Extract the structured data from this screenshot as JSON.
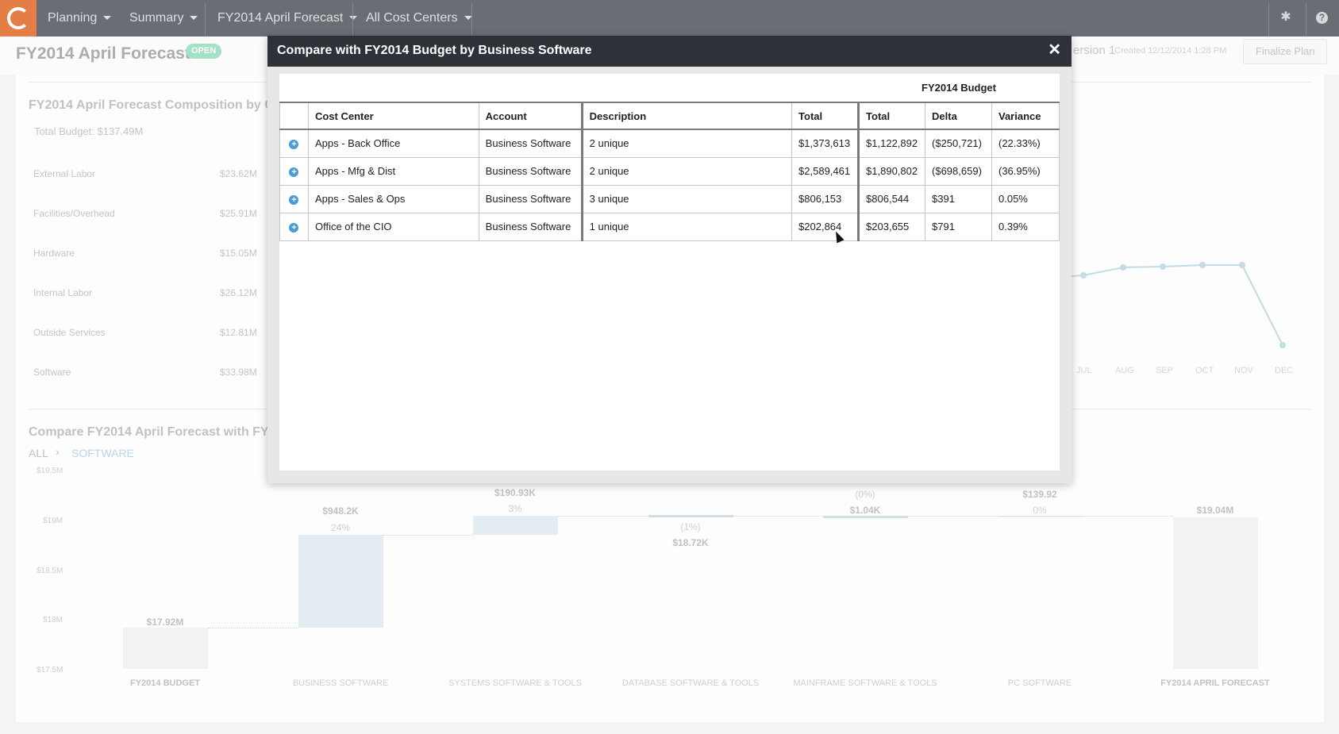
{
  "nav": {
    "items": [
      {
        "label": "Planning"
      },
      {
        "label": "Summary"
      },
      {
        "label": "FY2014 April Forecast"
      },
      {
        "label": "All Cost Centers"
      }
    ],
    "icons": {
      "settings": "gear-icon",
      "help": "question-icon",
      "logo": "app-logo"
    }
  },
  "header": {
    "title": "FY2014 April Forecast",
    "status": "OPEN",
    "version": "ersion 1",
    "created": "Created 12/12/2014 1:28 PM",
    "finalize_label": "Finalize Plan"
  },
  "composition": {
    "title": "FY2014 April Forecast Composition by Co",
    "total_budget": "Total Budget: $137.49M",
    "rows": [
      {
        "label": "External Labor",
        "value": "$23.62M"
      },
      {
        "label": "Facilities/Overhead",
        "value": "$25.91M"
      },
      {
        "label": "Hardware",
        "value": "$15.05M"
      },
      {
        "label": "Internal Labor",
        "value": "$26.12M"
      },
      {
        "label": "Outside Services",
        "value": "$12.81M"
      },
      {
        "label": "Software",
        "value": "$33.98M"
      }
    ]
  },
  "monthly_chart": {
    "months": [
      "JUL",
      "AUG",
      "SEP",
      "OCT",
      "NOV",
      "DEC"
    ],
    "line_color": "#b7d3e0"
  },
  "compare": {
    "title": "Compare FY2014 April Forecast with FY20",
    "breadcrumb": {
      "root": "ALL",
      "current": "SOFTWARE"
    },
    "y_axis": [
      "$19.5M",
      "$19M",
      "$18.5M",
      "$18M",
      "$17.5M"
    ],
    "bars": [
      {
        "category": "FY2014 BUDGET",
        "value": "$17.92M",
        "pct": ""
      },
      {
        "category": "BUSINESS SOFTWARE",
        "value": "$948.2K",
        "pct": "24%"
      },
      {
        "category": "SYSTEMS SOFTWARE & TOOLS",
        "value": "$190.93K",
        "pct": "3%"
      },
      {
        "category": "DATABASE SOFTWARE & TOOLS",
        "value": "$18.72K",
        "pct": "(1%)"
      },
      {
        "category": "MAINFRAME SOFTWARE & TOOLS",
        "value": "$1.04K",
        "pct": "(0%)"
      },
      {
        "category": "PC SOFTWARE",
        "value": "$139.92",
        "pct": "0%"
      },
      {
        "category": "FY2014 APRIL FORECAST",
        "value": "$19.04M",
        "pct": ""
      }
    ]
  },
  "modal": {
    "title": "Compare with FY2014 Budget by Business Software",
    "close_label": "✕",
    "group_header": "FY2014 Budget",
    "columns": [
      "Cost Center",
      "Account",
      "Description",
      "Total",
      "Total",
      "Delta",
      "Variance"
    ],
    "rows": [
      {
        "cost_center": "Apps - Back Office",
        "account": "Business Software",
        "description": "2 unique",
        "total": "$1,373,613",
        "budget_total": "$1,122,892",
        "delta": "($250,721)",
        "variance": "(22.33%)"
      },
      {
        "cost_center": "Apps - Mfg & Dist",
        "account": "Business Software",
        "description": "2 unique",
        "total": "$2,589,461",
        "budget_total": "$1,890,802",
        "delta": "($698,659)",
        "variance": "(36.95%)"
      },
      {
        "cost_center": "Apps - Sales & Ops",
        "account": "Business Software",
        "description": "3 unique",
        "total": "$806,153",
        "budget_total": "$806,544",
        "delta": "$391",
        "variance": "0.05%"
      },
      {
        "cost_center": "Office of the CIO",
        "account": "Business Software",
        "description": "1 unique",
        "total": "$202,864",
        "budget_total": "$203,655",
        "delta": "$791",
        "variance": "0.39%"
      }
    ]
  }
}
